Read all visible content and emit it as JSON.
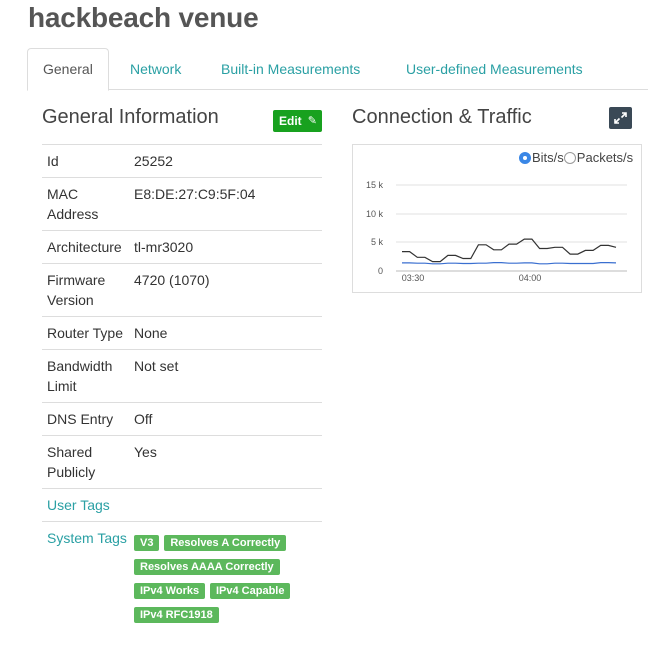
{
  "page_title": "hackbeach venue",
  "tabs": [
    {
      "label": "General",
      "active": true
    },
    {
      "label": "Network"
    },
    {
      "label": "Built-in Measurements"
    },
    {
      "label": "User-defined Measurements"
    }
  ],
  "general_info": {
    "title": "General Information",
    "edit_label": "Edit",
    "rows": [
      {
        "label": "Id",
        "value": "25252"
      },
      {
        "label": "MAC Address",
        "value": "E8:DE:27:C9:5F:04"
      },
      {
        "label": "Architecture",
        "value": "tl-mr3020"
      },
      {
        "label": "Firmware Version",
        "value": "4720 (1070)"
      },
      {
        "label": "Router Type",
        "value": "None"
      },
      {
        "label": "Bandwidth Limit",
        "value": "Not set"
      },
      {
        "label": "DNS Entry",
        "value": "Off"
      },
      {
        "label": "Shared Publicly",
        "value": "Yes"
      },
      {
        "label": "User Tags",
        "value": ""
      }
    ],
    "system_tags_label": "System Tags",
    "system_tags": [
      "V3",
      "Resolves A Correctly",
      "Resolves AAAA Correctly",
      "IPv4 Works",
      "IPv4 Capable",
      "IPv4 RFC1918"
    ]
  },
  "connection": {
    "title": "Connection & Traffic",
    "legend": [
      {
        "label": "Bits/s",
        "checked": true
      },
      {
        "label": "Packets/s",
        "checked": false
      }
    ]
  },
  "colors": {
    "accent": "#2aa0a4",
    "edit_button": "#18a11f",
    "tag": "#5cb85c",
    "rx_series": "#333333",
    "tx_series": "#3a6fd0"
  },
  "chart_data": {
    "type": "line",
    "x_ticks": [
      "03:30",
      "04:00"
    ],
    "y_ticks": [
      "0",
      "5 k",
      "10 k",
      "15 k"
    ],
    "ylim": [
      0,
      16000
    ],
    "series": [
      {
        "values": [
          3100,
          3100,
          2200,
          2200,
          1500,
          1500,
          2500,
          2500,
          2000,
          2000,
          4200,
          4200,
          3400,
          3400,
          4300,
          4300,
          5100,
          5100,
          3600,
          3600,
          3800,
          3800,
          2700,
          2700,
          3300,
          3300,
          4100,
          4100,
          3800
        ]
      },
      {
        "values": [
          1300,
          1300,
          1250,
          1250,
          1150,
          1150,
          1250,
          1250,
          1200,
          1200,
          1250,
          1250,
          1350,
          1350,
          1250,
          1250,
          1300,
          1300,
          1150,
          1150,
          1250,
          1250,
          1200,
          1200,
          1200,
          1200,
          1350,
          1350,
          1300
        ]
      }
    ]
  }
}
